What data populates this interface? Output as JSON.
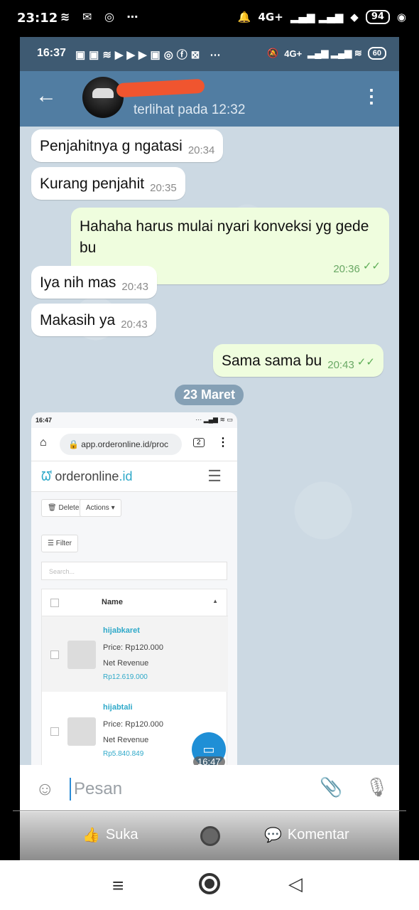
{
  "outer_status": {
    "time": "23:12",
    "network": "4G+",
    "battery": "94"
  },
  "inner_status": {
    "time": "16:37",
    "network": "4G+",
    "battery": "60"
  },
  "chat_header": {
    "last_seen": "terlihat pada 12:32"
  },
  "messages": [
    {
      "text": "Penjahitnya g ngatasi",
      "time": "20:34"
    },
    {
      "text": "Kurang penjahit",
      "time": "20:35"
    },
    {
      "text": "Hahaha harus mulai nyari konveksi yg gede bu",
      "time": "20:36"
    },
    {
      "text": "Iya nih mas",
      "time": "20:43"
    },
    {
      "text": "Makasih ya",
      "time": "20:43"
    },
    {
      "text": "Sama sama bu",
      "time": "20:43"
    }
  ],
  "date_separator": "23 Maret",
  "shot": {
    "time": "16:47",
    "url": "app.orderonline.id/proc",
    "tabs_count": "2",
    "brand": "orderonline",
    "brand_tld": ".id",
    "delete_label": "Delete",
    "actions_label": "Actions",
    "filter_label": "Filter",
    "search_placeholder": "Search...",
    "column_name": "Name",
    "products": [
      {
        "name": "hijabkaret",
        "price": "Price: Rp120.000",
        "net_label": "Net Revenue",
        "revenue": "Rp12.619.000"
      },
      {
        "name": "hijabtali",
        "price": "Price: Rp120.000",
        "net_label": "Net Revenue",
        "revenue": "Rp5.840.849"
      }
    ],
    "timestamp": "16:47"
  },
  "composer": {
    "placeholder": "Pesan"
  },
  "fb_bar": {
    "like_label": "Suka",
    "comment_label": "Komentar"
  }
}
